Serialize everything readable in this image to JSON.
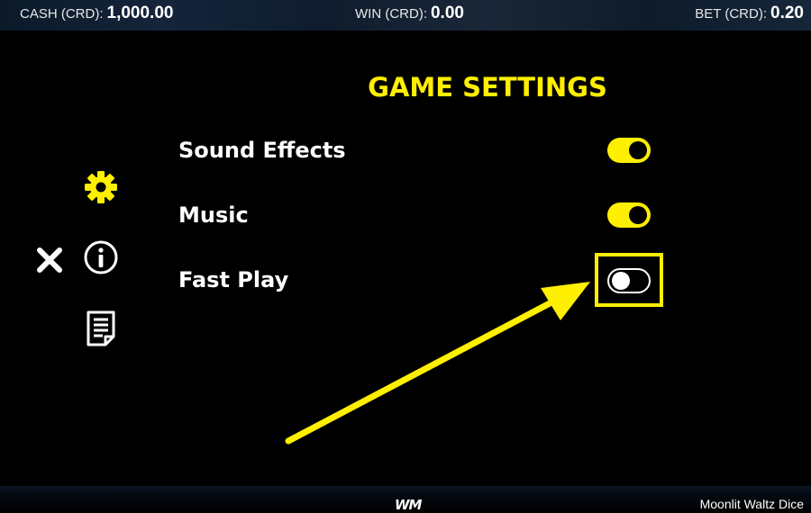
{
  "header": {
    "cash_label": "CASH (CRD):",
    "cash_value": "1,000.00",
    "win_label": "WIN (CRD):",
    "win_value": "0.00",
    "bet_label": "BET (CRD):",
    "bet_value": "0.20"
  },
  "panel": {
    "title": "GAME SETTINGS"
  },
  "sidebar": {
    "icons": [
      "gear-icon",
      "close-icon",
      "info-icon",
      "document-icon"
    ]
  },
  "settings": [
    {
      "label": "Sound Effects",
      "enabled": true
    },
    {
      "label": "Music",
      "enabled": true
    },
    {
      "label": "Fast Play",
      "enabled": false
    }
  ],
  "footer": {
    "logo": "WM",
    "game_name": "Moonlit Waltz Dice"
  },
  "colors": {
    "accent": "#ffef00",
    "background": "#000000",
    "text": "#ffffff"
  }
}
